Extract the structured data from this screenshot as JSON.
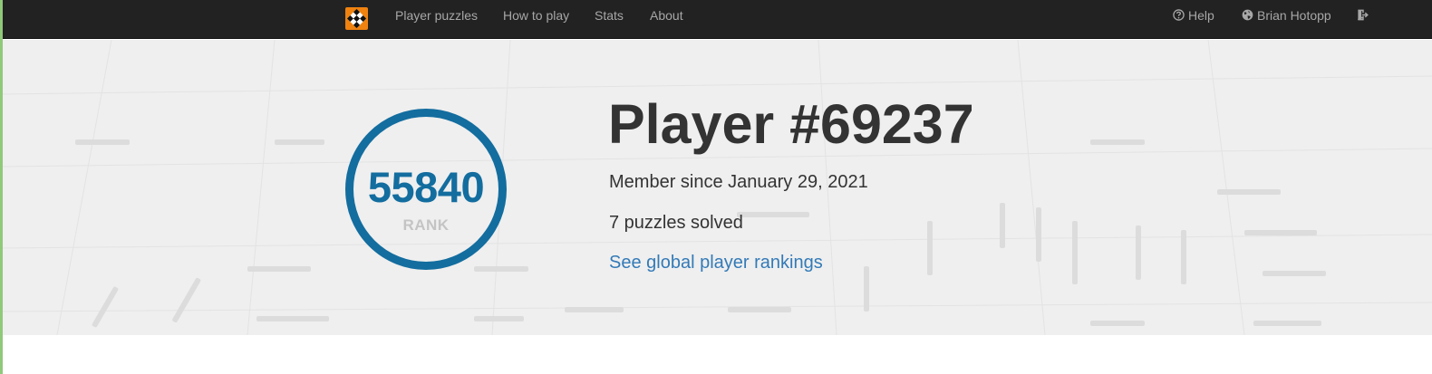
{
  "nav": {
    "brand_icon": "puzzle-logo-icon",
    "brand_color": "#f0820f",
    "links": [
      {
        "label": "Player puzzles"
      },
      {
        "label": "How to play"
      },
      {
        "label": "Stats"
      },
      {
        "label": "About"
      }
    ],
    "help_label": "Help",
    "help_icon": "question-circle-icon",
    "user_label": "Brian Hotopp",
    "user_icon": "globe-icon",
    "logout_icon": "sign-out-icon"
  },
  "profile": {
    "rank_value": "55840",
    "rank_label": "RANK",
    "title": "Player #69237",
    "member_since": "Member since January 29, 2021",
    "solved": "7 puzzles solved",
    "rankings_link": "See global player rankings"
  },
  "colors": {
    "navbar": "#222222",
    "accent": "#136d9f",
    "link": "#337ab7",
    "hero_bg": "#efefef"
  }
}
